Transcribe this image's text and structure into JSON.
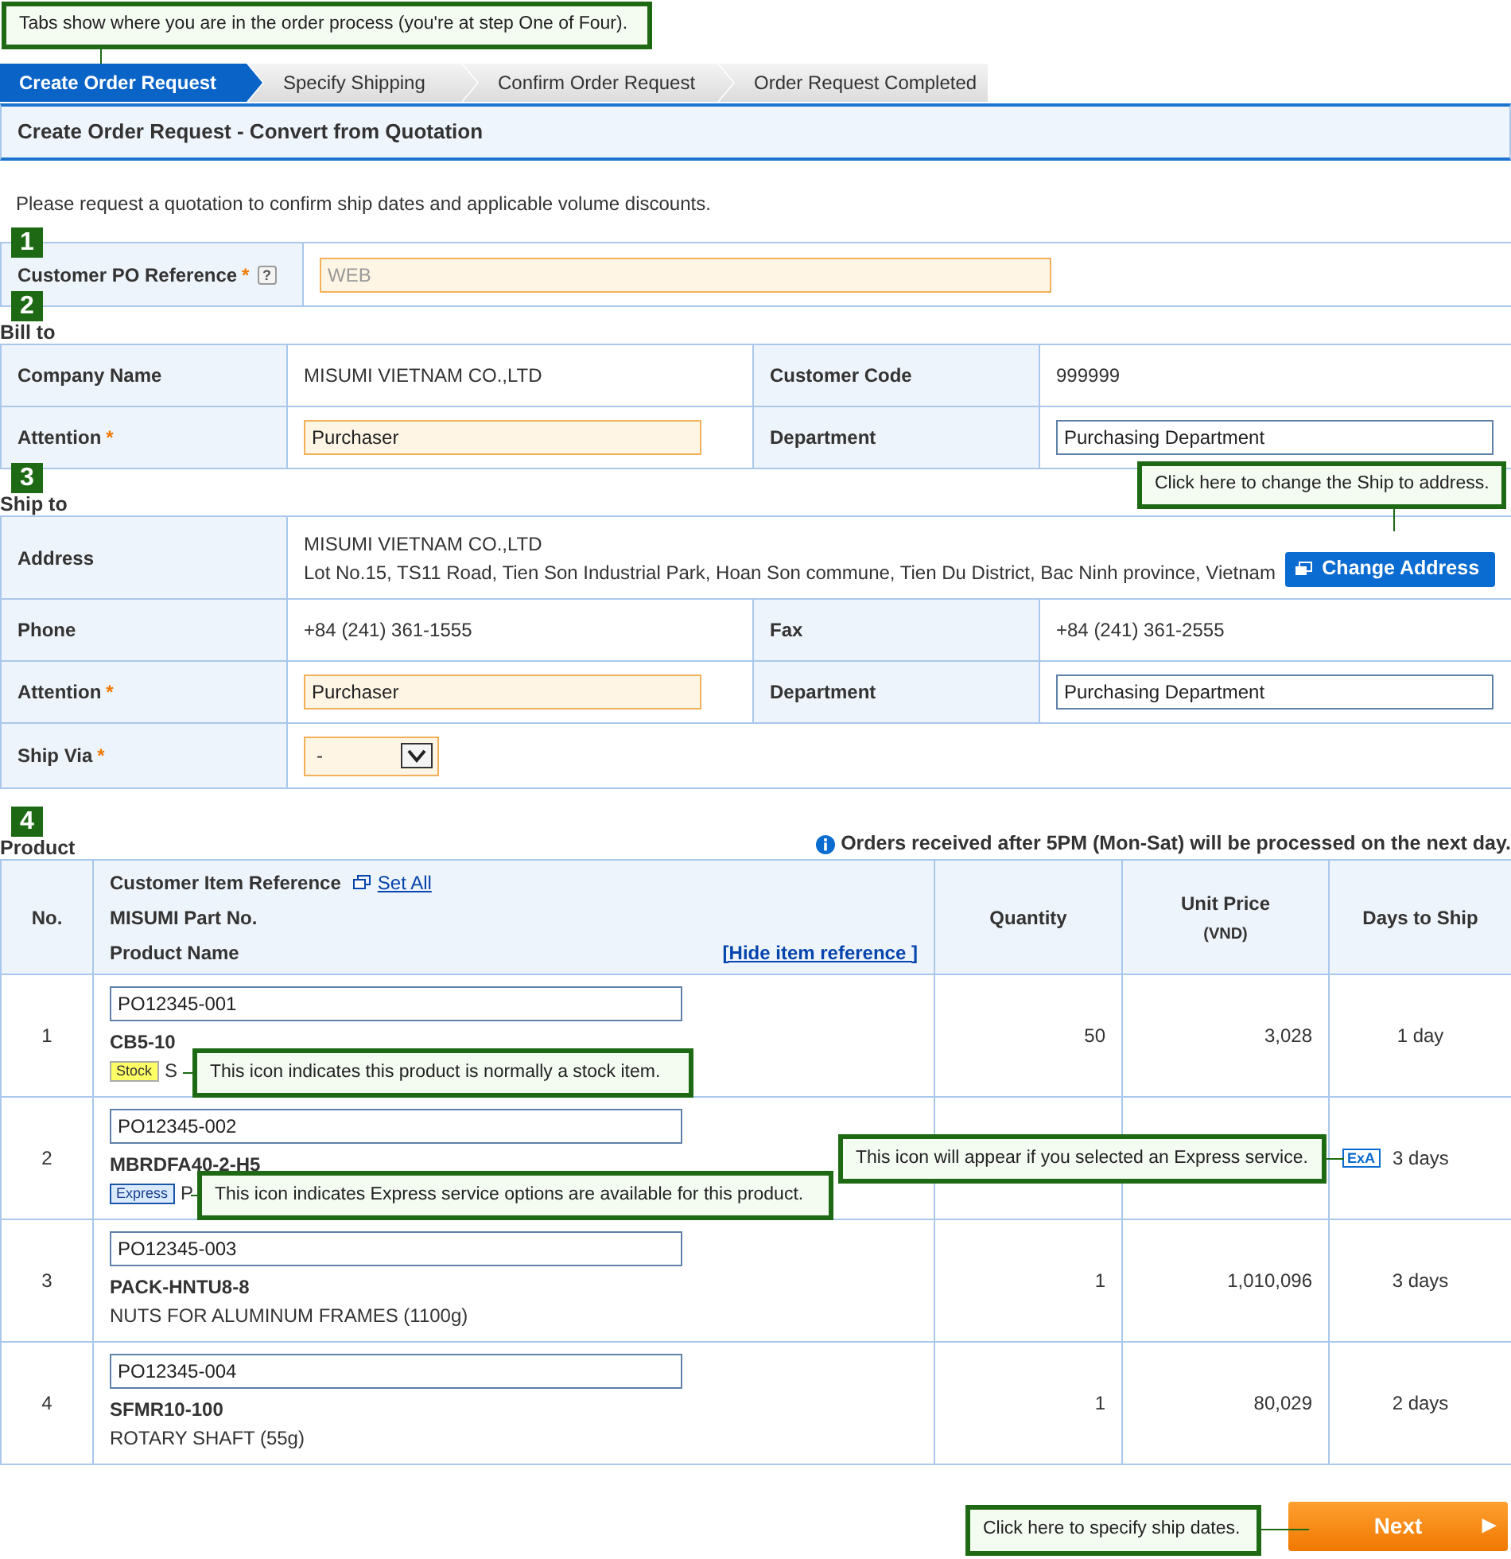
{
  "callouts": [
    {
      "text": "Tabs show where you are in the order process (you're at step One of Four)."
    },
    {
      "text": "Click here to change the Ship to address."
    },
    {
      "text": "This icon indicates this product is normally a stock item."
    },
    {
      "text": "This icon will appear if you selected an Express service."
    },
    {
      "text": "This icon indicates Express service options are available for this product."
    },
    {
      "text": "Click here to specify ship dates."
    }
  ],
  "tabs": [
    {
      "label": "Create Order Request",
      "selected": true
    },
    {
      "label": "Specify Shipping",
      "selected": false
    },
    {
      "label": "Confirm Order Request",
      "selected": false
    },
    {
      "label": "Order Request Completed",
      "selected": false
    }
  ],
  "page_title": "Create Order Request - Convert from Quotation",
  "intro": "Please request a quotation to confirm ship dates and applicable volume discounts.",
  "po_section": {
    "step": "1",
    "label": "Customer PO Reference",
    "required_mark": "*",
    "help": "?",
    "placeholder": "WEB"
  },
  "bill_to": {
    "step": "2",
    "heading": "Bill to",
    "rows": [
      [
        {
          "label": "Company Name",
          "value": "MISUMI VIETNAM CO.,LTD"
        },
        {
          "label": "Customer Code",
          "value": "999999"
        }
      ],
      [
        {
          "label": "Attention",
          "required_mark": "*",
          "input": "Purchaser"
        },
        {
          "label": "Department",
          "input": "Purchasing Department"
        }
      ]
    ]
  },
  "ship_to": {
    "step": "3",
    "heading": "Ship to",
    "address": {
      "label": "Address",
      "lines": [
        "MISUMI VIETNAM CO.,LTD",
        "Lot No.15, TS11 Road, Tien Son Industrial Park, Hoan Son commune, Tien Du District, Bac Ninh province, Vietnam"
      ],
      "button": "Change Address"
    },
    "rows": [
      [
        {
          "label": "Phone",
          "value": "+84 (241) 361-1555"
        },
        {
          "label": "Fax",
          "value": "+84 (241) 361-2555"
        }
      ],
      [
        {
          "label": "Attention",
          "required_mark": "*",
          "input": "Purchaser"
        },
        {
          "label": "Department",
          "input": "Purchasing Department"
        }
      ]
    ],
    "ship_via": {
      "label": "Ship Via",
      "required_mark": "*",
      "value": "-"
    }
  },
  "product": {
    "step": "4",
    "heading": "Product",
    "notice": "Orders received after 5PM (Mon-Sat) will be processed on the next day.",
    "columns": {
      "no": "No.",
      "item_lines": [
        "Customer Item Reference",
        "MISUMI Part No.",
        "Product Name"
      ],
      "set_all": "Set All",
      "hide_reference": "[Hide item reference ]",
      "quantity": "Quantity",
      "unit_price": "Unit Price",
      "currency": "(VND)",
      "days": "Days to Ship"
    },
    "rows": [
      {
        "no": "1",
        "reference": "PO12345-001",
        "part_no": "CB5-10",
        "tag": {
          "kind": "stock",
          "label": "Stock"
        },
        "name": "S",
        "quantity": "50",
        "unit_price": "3,028",
        "days": "1 day"
      },
      {
        "no": "2",
        "reference": "PO12345-002",
        "part_no": "MBRDFA40-2-H5",
        "tag": {
          "kind": "express",
          "label": "Express"
        },
        "name": "P",
        "express_mark": "ExA",
        "days": "3 days"
      },
      {
        "no": "3",
        "reference": "PO12345-003",
        "part_no": "PACK-HNTU8-8",
        "name": "NUTS FOR ALUMINUM FRAMES (1100g)",
        "quantity": "1",
        "unit_price": "1,010,096",
        "days": "3 days"
      },
      {
        "no": "4",
        "reference": "PO12345-004",
        "part_no": "SFMR10-100",
        "name": "ROTARY SHAFT (55g)",
        "quantity": "1",
        "unit_price": "80,029",
        "days": "2 days"
      }
    ]
  },
  "next_button": {
    "label": "Next",
    "arrow": "▶"
  }
}
